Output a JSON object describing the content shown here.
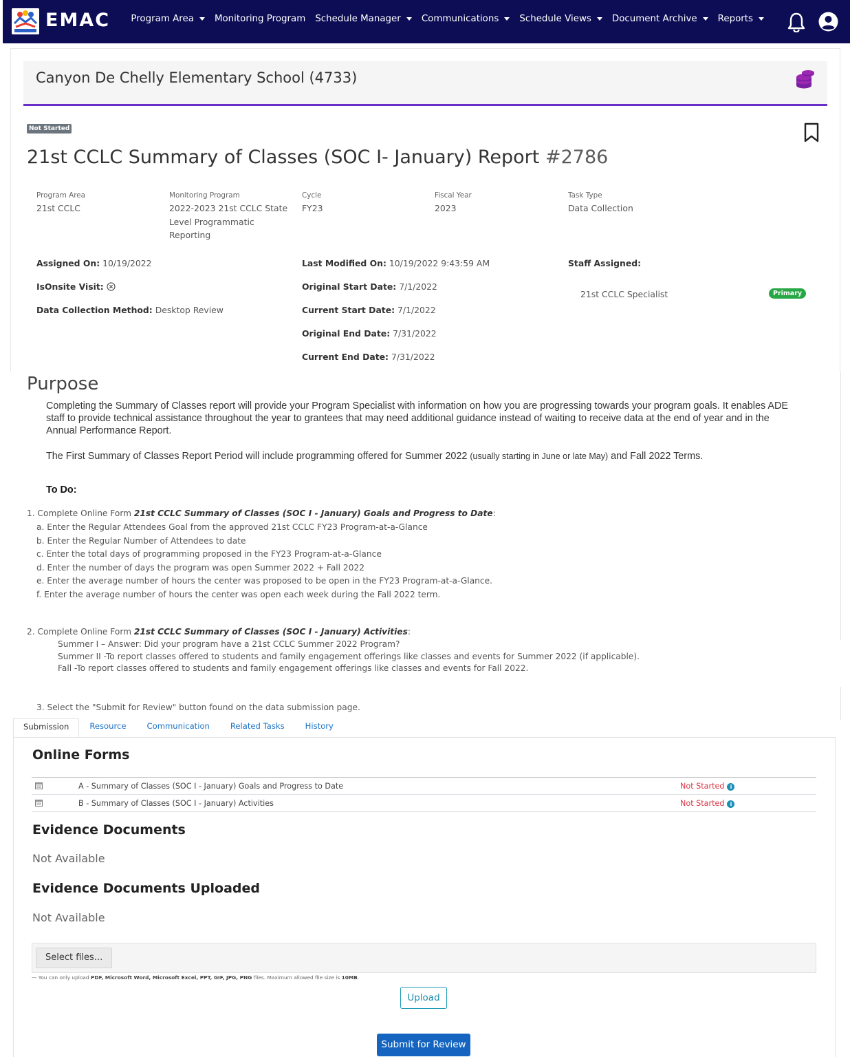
{
  "nav": {
    "brand": "EMAC",
    "items": [
      {
        "label": "Program Area",
        "dropdown": true
      },
      {
        "label": "Monitoring Program",
        "dropdown": false
      },
      {
        "label": "Schedule Manager",
        "dropdown": true
      },
      {
        "label": "Communications",
        "dropdown": true
      },
      {
        "label": "Schedule Views",
        "dropdown": true
      },
      {
        "label": "Document Archive",
        "dropdown": true
      },
      {
        "label": "Reports",
        "dropdown": true
      }
    ],
    "bg_color": "#0d0d56"
  },
  "school": {
    "name": "Canyon De Chelly Elementary School (4733)",
    "accent": "#6b2fc9"
  },
  "report": {
    "status": "Not Started",
    "title": "21st CCLC Summary of Classes (SOC I- January) Report",
    "number": "#2786"
  },
  "meta": {
    "program_area_label": "Program Area",
    "program_area_value": "21st CCLC",
    "monitoring_program_label": "Monitoring Program",
    "monitoring_program_line1": "2022-2023 21st CCLC State",
    "monitoring_program_line2": "Level Programmatic",
    "monitoring_program_line3": "Reporting",
    "cycle_label": "Cycle",
    "cycle_value": "FY23",
    "fiscal_year_label": "Fiscal Year",
    "fiscal_year_value": "2023",
    "task_type_label": "Task Type",
    "task_type_value": "Data Collection"
  },
  "info": {
    "assigned_on_label": "Assigned On:",
    "assigned_on_value": "10/19/2022",
    "onsite_label": "IsOnsite Visit:",
    "method_label": "Data Collection Method:",
    "method_value": "Desktop Review",
    "last_modified_label": "Last Modified On:",
    "last_modified_value": "10/19/2022 9:43:59 AM",
    "orig_start_label": "Original Start Date:",
    "orig_start_value": "7/1/2022",
    "curr_start_label": "Current Start Date:",
    "curr_start_value": "7/1/2022",
    "orig_end_label": "Original End Date:",
    "orig_end_value": "7/31/2022",
    "curr_end_label": "Current End Date:",
    "curr_end_value": "7/31/2022",
    "staff_label": "Staff Assigned:",
    "staff_name": "21st CCLC Specialist",
    "staff_badge": "Primary"
  },
  "purpose": {
    "heading": "Purpose",
    "p1_line1": "Completing the Summary of Classes report will provide your Program Specialist with information on how you are progressing towards your program goals. It enables ADE",
    "p1_line2": "staff to provide technical assistance throughout the year to grantees that may need additional guidance instead of waiting to receive data at the end of year and in the",
    "p1_line3": "Annual Performance Report.",
    "p2_start": "The First Summary of Classes Report Period will include programming offered for Summer 2022",
    "p2_paren": "(usually starting in June or late May)",
    "p2_end": "and Fall 2022 Terms.",
    "todo_heading": "To Do:",
    "step1_prefix": "1. Complete Online Form",
    "step1_form": "21st CCLC Summary of Classes (SOC I - January) Goals and Progress to Date",
    "step1_items": [
      "a. Enter the Regular Attendees Goal from the approved 21st CCLC FY23 Program-at-a-Glance",
      "b. Enter the Regular Number of Attendees to date",
      "c. Enter the total days of programming proposed in the FY23 Program-at-a-Glance",
      "d. Enter the number of days the program was open Summer 2022 + Fall 2022",
      "e. Enter the average number of hours the center was proposed to be open in the FY23 Program-at-a-Glance.",
      "f.  Enter the average number of hours the center was open each week during the Fall 2022 term."
    ],
    "step2_prefix": "2. Complete Online Form",
    "step2_form": "21st CCLC Summary of Classes (SOC I - January) Activities",
    "step2_items": [
      "Summer I – Answer: Did your program have a 21st CCLC Summer 2022 Program?",
      "Summer II -To report classes offered to students and family engagement offerings like classes and events for Summer 2022 (if applicable).",
      "Fall -To report classes offered to students and family engagement offerings like classes and events for Fall 2022."
    ],
    "step3": "3. Select the \"Submit for Review\" button found on the data submission page."
  },
  "tabs": [
    "Submission",
    "Resource",
    "Communication",
    "Related Tasks",
    "History"
  ],
  "submission": {
    "online_forms_heading": "Online Forms",
    "forms": [
      {
        "name": "A - Summary of Classes (SOC I - January) Goals and Progress to Date",
        "status": "Not Started"
      },
      {
        "name": "B - Summary of Classes (SOC I - January) Activities",
        "status": "Not Started"
      }
    ],
    "evidence_heading": "Evidence Documents",
    "evidence_value": "Not Available",
    "uploaded_heading": "Evidence Documents Uploaded",
    "uploaded_value": "Not Available",
    "select_files": "Select files...",
    "hint_prefix": "— You can only upload",
    "hint_types": "PDF, Microsoft Word, Microsoft Excel, PPT, GIF, JPG, PNG",
    "hint_mid": "files. Maximum allowed file size is",
    "hint_size": "10MB",
    "upload_label": "Upload",
    "submit_label": "Submit for Review"
  }
}
